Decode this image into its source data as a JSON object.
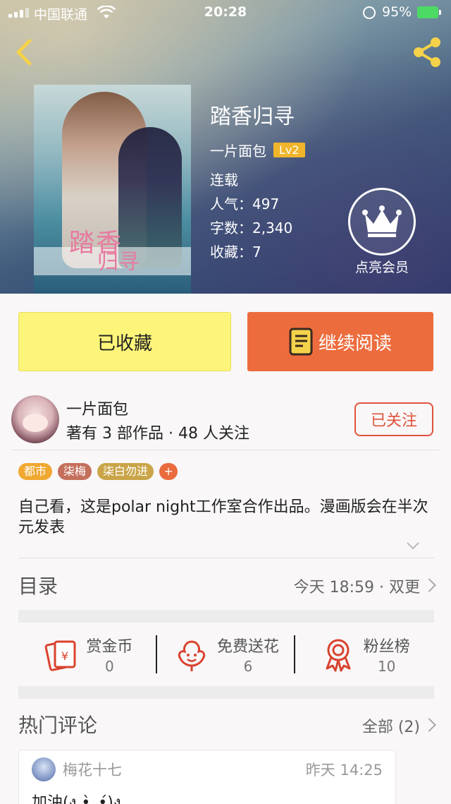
{
  "status_bar": {
    "carrier": "中国联通",
    "time": "20:28",
    "battery": "95%"
  },
  "book": {
    "title": "踏香归寻",
    "cover_text_1": "踏香",
    "cover_text_2": "归寻",
    "author": "一片面包",
    "author_level": "Lv2",
    "status": "连载",
    "popularity": "人气：497",
    "word_count": "字数：2,340",
    "favorites": "收藏：7"
  },
  "vip": {
    "label": "点亮会员"
  },
  "actions": {
    "collected_label": "已收藏",
    "read_label": "继续阅读"
  },
  "author_card": {
    "name": "一片面包",
    "meta": "著有 3 部作品 · 48 人关注",
    "follow_label": "已关注"
  },
  "tags": [
    {
      "label": "都市",
      "color": "#f0a830"
    },
    {
      "label": "柒梅",
      "color": "#c46f5d"
    },
    {
      "label": "柒白勿进",
      "color": "#c9a548"
    }
  ],
  "tag_add": "+",
  "intro": "自己看，这是polar night工作室合作出品。漫画版会在半次元发表",
  "catalog": {
    "title": "目录",
    "update": "今天 18:59 · 双更"
  },
  "stats": [
    {
      "name": "赏金币",
      "value": "0",
      "icon": "red-envelope-icon"
    },
    {
      "name": "免费送花",
      "value": "6",
      "icon": "flower-icon"
    },
    {
      "name": "粉丝榜",
      "value": "10",
      "icon": "medal-icon"
    }
  ],
  "hot_comments": {
    "title": "热门评论",
    "all_label": "全部 (2)",
    "items": [
      {
        "user": "梅花十七",
        "time": "昨天 14:25",
        "text": "加油(ง •̀_•́)ง"
      }
    ]
  },
  "colors": {
    "accent_orange": "#ed6c3e",
    "accent_yellow": "#fdf57a",
    "follow_red": "#e0533d",
    "icon_red": "#d9432f",
    "level_badge": "#f0b52a"
  }
}
